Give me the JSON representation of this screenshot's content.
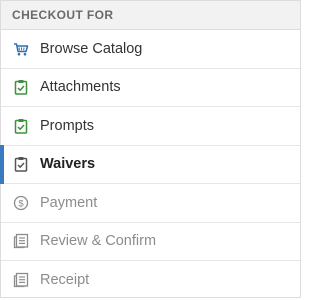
{
  "header": {
    "title": "CHECKOUT FOR"
  },
  "colors": {
    "active_bar": "#3a7bbf",
    "complete_icon": "#3f8f3f",
    "catalog_icon": "#2f6fb2",
    "disabled": "#8c8c8c"
  },
  "steps": [
    {
      "label": "Browse Catalog",
      "icon": "cart-icon",
      "state": "link"
    },
    {
      "label": "Attachments",
      "icon": "clipboard-check-icon",
      "state": "complete"
    },
    {
      "label": "Prompts",
      "icon": "clipboard-check-icon",
      "state": "complete"
    },
    {
      "label": "Waivers",
      "icon": "clipboard-check-icon",
      "state": "active"
    },
    {
      "label": "Payment",
      "icon": "dollar-circle-icon",
      "state": "disabled"
    },
    {
      "label": "Review & Confirm",
      "icon": "document-icon",
      "state": "disabled"
    },
    {
      "label": "Receipt",
      "icon": "document-icon",
      "state": "disabled"
    }
  ]
}
